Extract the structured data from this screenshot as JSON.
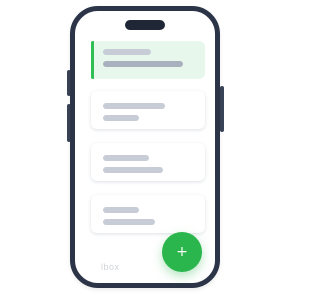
{
  "app": {
    "fab_label": "+",
    "watermark": "lbox"
  },
  "colors": {
    "frame": "#2c3548",
    "accent": "#2fbf55",
    "selected_bg": "#e8f7ec",
    "placeholder": "#c7ccd6"
  },
  "list": {
    "items": [
      {
        "state": "selected"
      },
      {
        "state": "default"
      },
      {
        "state": "default"
      },
      {
        "state": "default"
      }
    ]
  },
  "icons": {
    "fab": "plus-icon"
  }
}
